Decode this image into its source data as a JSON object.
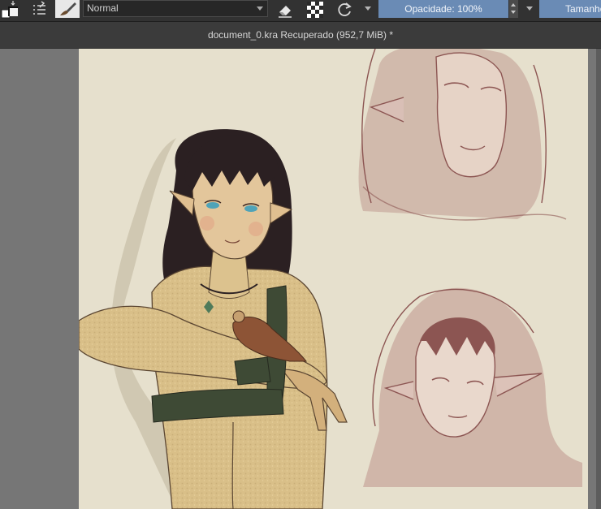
{
  "toolbar": {
    "blend_mode": "Normal",
    "opacity_label": "Opacidade: 100%",
    "size_label": "Tamanho",
    "icons": [
      "color-swatch-icon",
      "brush-presets-icon",
      "brush-editor-icon",
      "eraser-icon",
      "alpha-lock-icon",
      "reload-preset-icon"
    ]
  },
  "document": {
    "title": "document_0.kra Recuperado (952,7 MiB) *"
  },
  "colors": {
    "toolbar_bg": "#323232",
    "accent": "#6a8bb5",
    "canvas_bg": "#767676",
    "paper": "#e6e0cd",
    "hair": "#2b2022",
    "skin": "#dcc28e",
    "strap": "#3e4a35",
    "sketch": "#8c5552"
  }
}
